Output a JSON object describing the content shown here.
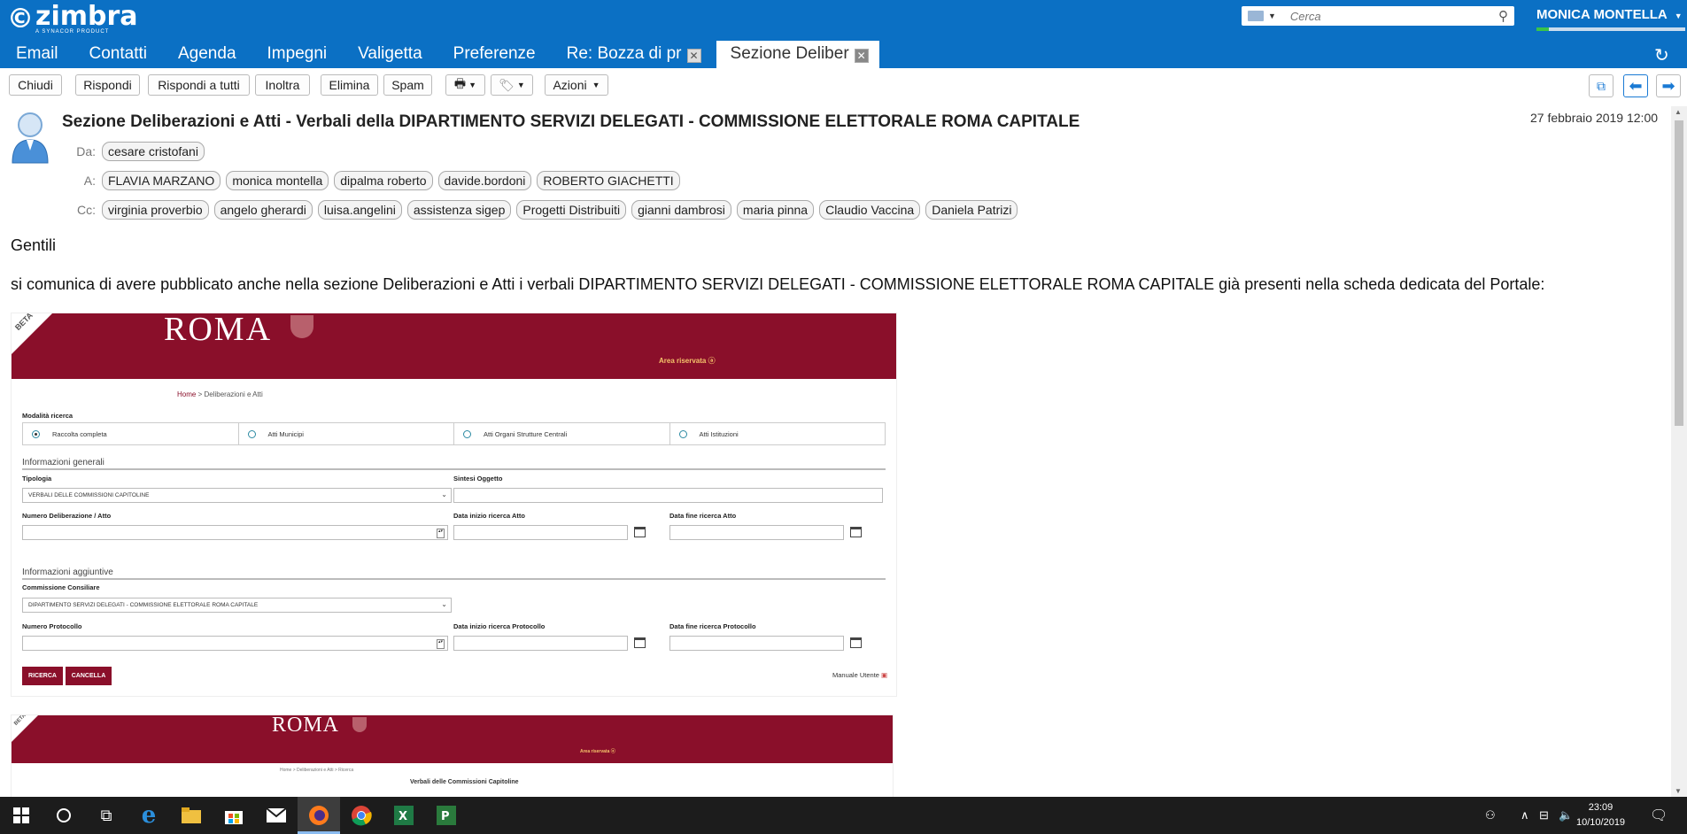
{
  "app": {
    "logo_mark": "©",
    "logo_name": "zimbra",
    "logo_sub": "A SYNACOR PRODUCT",
    "search_placeholder": "Cerca",
    "user": "MONICA MONTELLA",
    "nav_tabs": [
      "Email",
      "Contatti",
      "Agenda",
      "Impegni",
      "Valigetta",
      "Preferenze"
    ],
    "open_tabs": [
      {
        "label": "Re: Bozza di pr",
        "active": false
      },
      {
        "label": "Sezione Deliber",
        "active": true
      }
    ]
  },
  "toolbar": {
    "close": "Chiudi",
    "reply": "Rispondi",
    "reply_all": "Rispondi a tutti",
    "forward": "Inoltra",
    "delete": "Elimina",
    "spam": "Spam",
    "actions": "Azioni"
  },
  "message": {
    "subject": "Sezione Deliberazioni e Atti - Verbali della DIPARTIMENTO SERVIZI DELEGATI - COMMISSIONE ELETTORALE ROMA CAPITALE",
    "date": "27 febbraio 2019 12:00",
    "from_label": "Da:",
    "from": [
      "cesare cristofani"
    ],
    "to_label": "A:",
    "to": [
      "FLAVIA MARZANO",
      "monica montella",
      "dipalma roberto",
      "davide.bordoni",
      "ROBERTO GIACHETTI"
    ],
    "cc_label": "Cc:",
    "cc": [
      "virginia proverbio",
      "angelo gherardi",
      "luisa.angelini",
      "assistenza sigep",
      "Progetti Distribuiti",
      "gianni dambrosi",
      "maria pinna",
      "Claudio Vaccina",
      "Daniela Patrizi"
    ],
    "greeting": "Gentili",
    "paragraph": "si comunica di avere pubblicato anche nella sezione Deliberazioni e Atti i verbali DIPARTIMENTO SERVIZI DELEGATI - COMMISSIONE ELETTORALE ROMA CAPITALE già presenti nella scheda dedicata del Portale:"
  },
  "embedded": {
    "beta": "BETA",
    "roma": "ROMA",
    "area": "Area riservata ⓐ",
    "crumb_home": "Home",
    "crumb_rest": ">  Deliberazioni e Atti",
    "modalita": "Modalità ricerca",
    "radios": [
      {
        "label": "Raccolta completa",
        "checked": true
      },
      {
        "label": "Atti Municipi",
        "checked": false
      },
      {
        "label": "Atti Organi Strutture Centrali",
        "checked": false
      },
      {
        "label": "Atti Istituzioni",
        "checked": false
      }
    ],
    "info_generali": "Informazioni generali",
    "tipologia": "Tipologia",
    "tipologia_value": "VERBALI DELLE COMMISSIONI CAPITOLINE",
    "sintesi": "Sintesi Oggetto",
    "numero_delib": "Numero Deliberazione / Atto",
    "data_inizio_atto": "Data inizio ricerca Atto",
    "data_fine_atto": "Data fine ricerca Atto",
    "info_aggiuntive": "Informazioni aggiuntive",
    "commissione": "Commissione Consiliare",
    "commissione_value": "DIPARTIMENTO SERVIZI DELEGATI - COMMISSIONE ELETTORALE ROMA CAPITALE",
    "numero_protocollo": "Numero Protocollo",
    "data_inizio_prot": "Data inizio ricerca Protocollo",
    "data_fine_prot": "Data fine ricerca Protocollo",
    "ricerca": "RICERCA",
    "cancella": "CANCELLA",
    "manuale": "Manuale Utente",
    "shot2_area": "Area riservata ⓐ",
    "shot2_crumb": "Home  >  Deliberazioni e Atti  >  Ricerca",
    "shot2_title": "Verbali delle Commissioni Capitoline"
  },
  "taskbar": {
    "time": "23:09",
    "date": "10/10/2019"
  }
}
